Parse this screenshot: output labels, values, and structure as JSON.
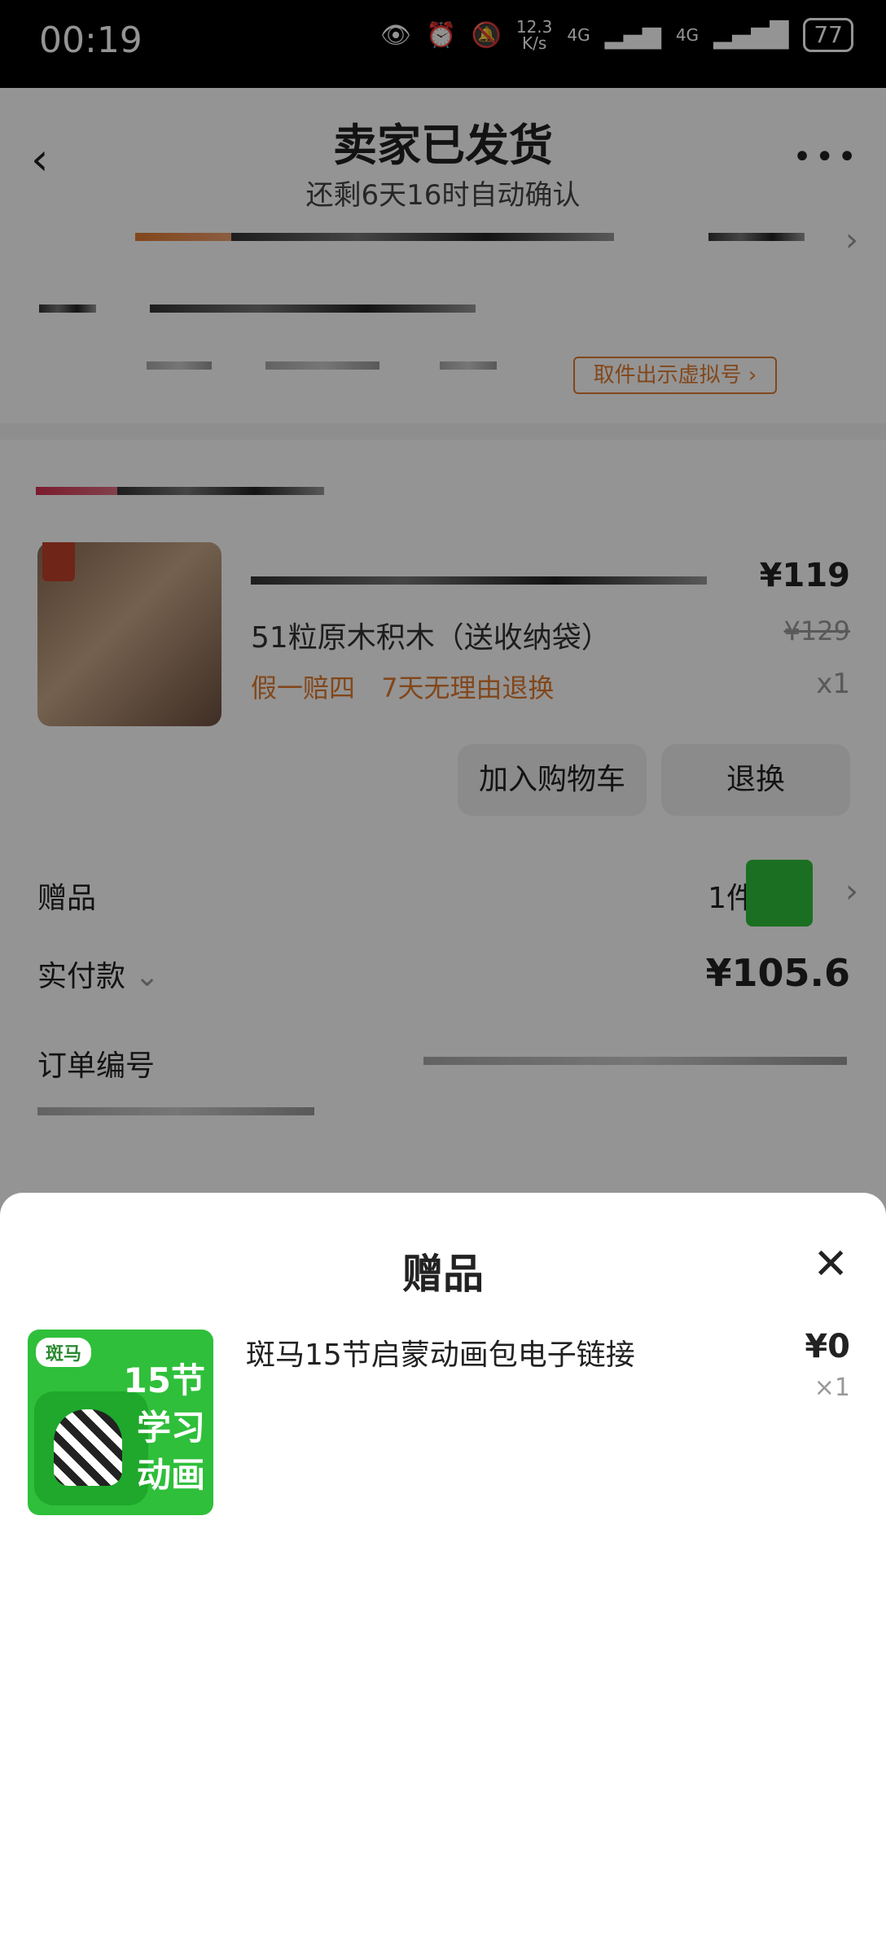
{
  "status_bar": {
    "time": "00:19",
    "net_speed_value": "12.3",
    "net_speed_unit": "K/s",
    "signal_1": "4G",
    "signal_2": "4G",
    "battery": "77"
  },
  "header": {
    "title": "卖家已发货",
    "subtitle": "还剩6天16时自动确认"
  },
  "logistics": {
    "virtual_number_button": "取件出示虚拟号 ›"
  },
  "product": {
    "name": "51粒原木积木（送收纳袋）",
    "tags": [
      "假一赔四",
      "7天无理由退换"
    ],
    "price": "¥119",
    "original_price": "¥129",
    "quantity": "x1",
    "add_to_cart": "加入购物车",
    "return_exchange": "退换"
  },
  "gift_row": {
    "label": "赠品",
    "count": "1件"
  },
  "paid_row": {
    "label": "实付款",
    "amount": "¥105.6"
  },
  "order_row": {
    "label": "订单编号"
  },
  "gift_sheet": {
    "title": "赠品",
    "item": {
      "brand": "斑马",
      "image_text_1": "15节",
      "image_text_2": "学习",
      "image_text_3": "动画",
      "name": "斑马15节启蒙动画包电子链接",
      "price": "¥0",
      "quantity": "×1"
    }
  },
  "icons": {
    "back": "chevron-left-icon",
    "more": "more-dots-icon",
    "close": "close-icon",
    "eye": "eye-icon",
    "alarm": "alarm-icon",
    "mute": "bell-off-icon"
  }
}
